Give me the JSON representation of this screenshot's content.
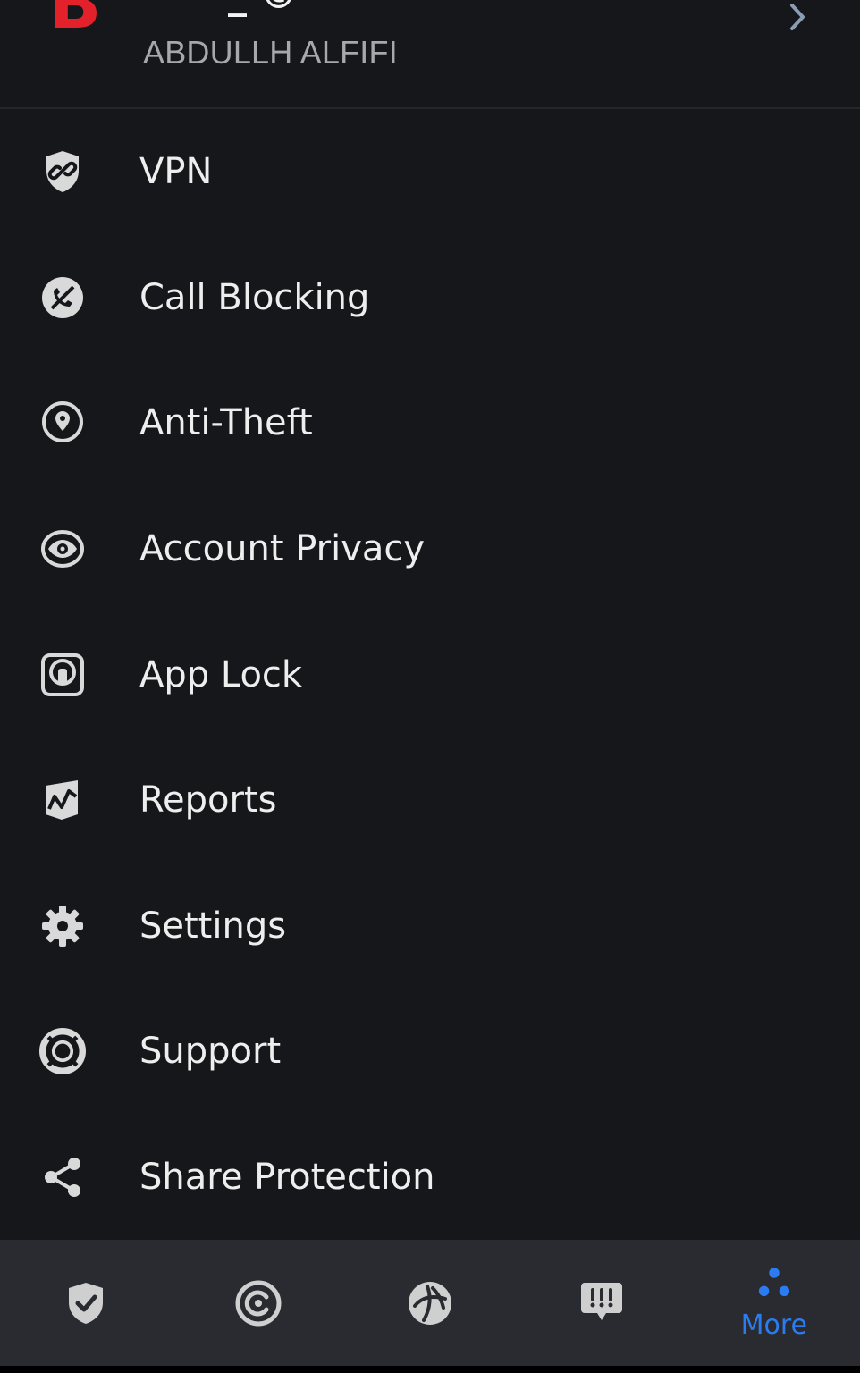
{
  "account": {
    "logo_letter": "B",
    "top_text": "_   ©",
    "name": "ABDULLH ALFIFI"
  },
  "menu": {
    "items": [
      {
        "label": "VPN",
        "icon": "vpn-shield-icon"
      },
      {
        "label": "Call Blocking",
        "icon": "call-blocking-icon"
      },
      {
        "label": "Anti-Theft",
        "icon": "location-pin-icon"
      },
      {
        "label": "Account Privacy",
        "icon": "eye-icon"
      },
      {
        "label": "App Lock",
        "icon": "app-lock-icon"
      },
      {
        "label": "Reports",
        "icon": "reports-icon"
      },
      {
        "label": "Settings",
        "icon": "gear-icon"
      },
      {
        "label": "Support",
        "icon": "lifebuoy-icon"
      },
      {
        "label": "Share Protection",
        "icon": "share-icon"
      }
    ]
  },
  "tabbar": {
    "tabs": [
      {
        "icon": "shield-check-icon",
        "label": ""
      },
      {
        "icon": "privacy-c-icon",
        "label": ""
      },
      {
        "icon": "utilities-icon",
        "label": ""
      },
      {
        "icon": "notifications-icon",
        "label": ""
      },
      {
        "icon": "more-dots-icon",
        "label": "More"
      }
    ],
    "active_color": "#2b7cf0"
  },
  "colors": {
    "background": "#16171a",
    "brand_red": "#e3212b",
    "tabbar_bg": "#2a2b30"
  }
}
